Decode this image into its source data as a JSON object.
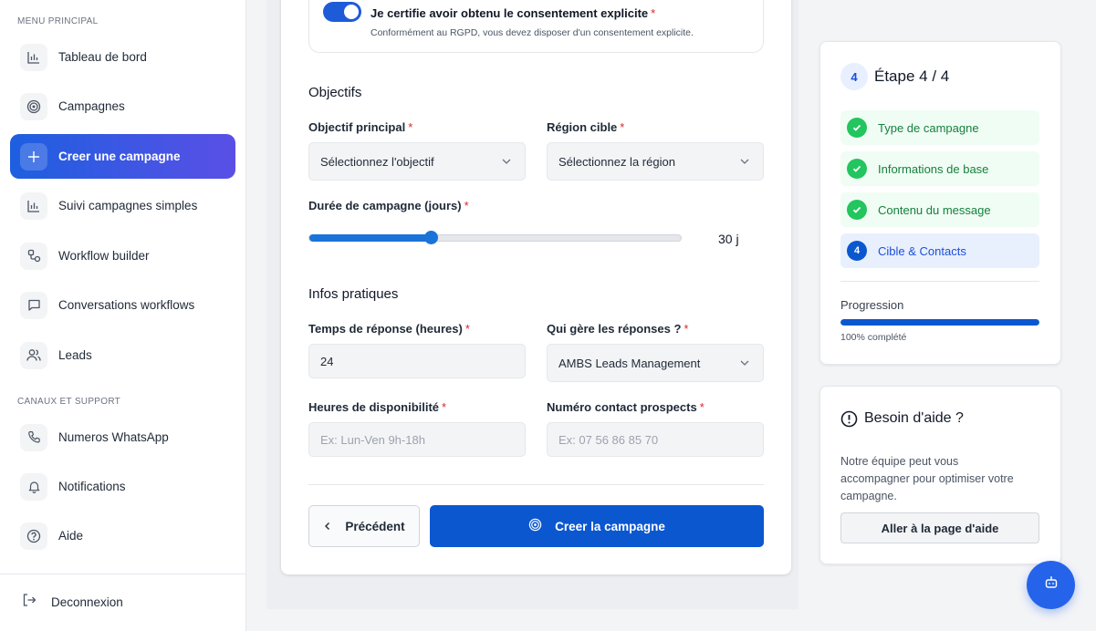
{
  "sidebar": {
    "section_main": "MENU PRINCIPAL",
    "section_channels": "CANAUX ET SUPPORT",
    "items": [
      {
        "label": "Tableau de bord",
        "icon": "bar-chart-icon"
      },
      {
        "label": "Campagnes",
        "icon": "target-icon"
      },
      {
        "label": "Creer une campagne",
        "icon": "plus-icon",
        "active": true
      },
      {
        "label": "Suivi campagnes simples",
        "icon": "bar-chart-icon"
      },
      {
        "label": "Workflow builder",
        "icon": "workflow-icon"
      },
      {
        "label": "Conversations workflows",
        "icon": "message-icon"
      },
      {
        "label": "Leads",
        "icon": "users-icon"
      }
    ],
    "support_items": [
      {
        "label": "Numeros WhatsApp",
        "icon": "phone-icon"
      },
      {
        "label": "Notifications",
        "icon": "bell-icon"
      },
      {
        "label": "Aide",
        "icon": "help-circle-icon"
      }
    ],
    "logout_label": "Deconnexion"
  },
  "form": {
    "consent": {
      "title": "Je certifie avoir obtenu le consentement explicite",
      "subtitle": "Conformément au RGPD, vous devez disposer d'un consentement explicite.",
      "checked": true
    },
    "objectives": {
      "title": "Objectifs",
      "main_objective_label": "Objectif principal",
      "main_objective_value": "Sélectionnez l'objectif",
      "region_label": "Région cible",
      "region_value": "Sélectionnez la région",
      "duration_label": "Durée de campagne (jours)",
      "duration_value": 30,
      "duration_min": 1,
      "duration_max": 90,
      "duration_display": "30 j"
    },
    "practical": {
      "title": "Infos pratiques",
      "response_time_label": "Temps de réponse (heures)",
      "response_time_value": "24",
      "handler_label": "Qui gère les réponses ?",
      "handler_value": "AMBS Leads Management",
      "availability_label": "Heures de disponibilité",
      "availability_placeholder": "Ex: Lun-Ven 9h-18h",
      "contact_label": "Numéro contact prospects",
      "contact_placeholder": "Ex: 07 56 86 85 70"
    },
    "required_mark": "*",
    "prev_button": "Précédent",
    "create_button": "Creer la campagne"
  },
  "steps": {
    "badge": "4",
    "title": "Étape 4 / 4",
    "items": [
      {
        "label": "Type de campagne",
        "status": "done"
      },
      {
        "label": "Informations de base",
        "status": "done"
      },
      {
        "label": "Contenu du message",
        "status": "done"
      },
      {
        "label": "Cible & Contacts",
        "status": "current",
        "number": "4"
      }
    ],
    "progress_label": "Progression",
    "progress_percent": 100,
    "progress_text": "100% complété"
  },
  "help": {
    "title": "Besoin d'aide ?",
    "text": "Notre équipe peut vous accompagner pour optimiser votre campagne.",
    "button": "Aller à la page d'aide"
  },
  "colors": {
    "primary": "#0b57d0",
    "success": "#22c55e",
    "required": "#dc2626"
  }
}
